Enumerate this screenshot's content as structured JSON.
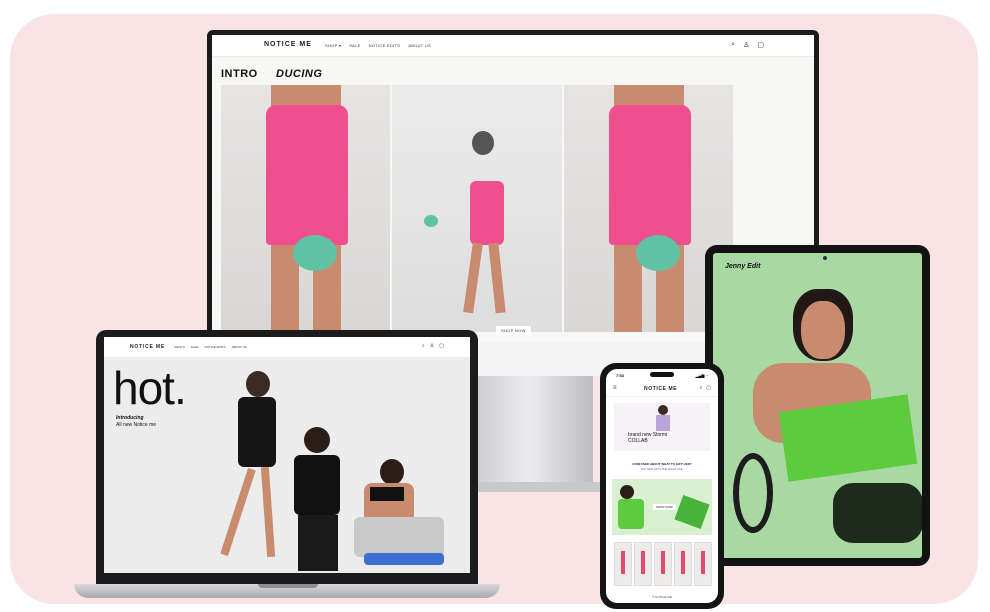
{
  "monitor": {
    "logo": "NOTICE ME",
    "nav_links": [
      "SHOP ▾",
      "SALE",
      "NOTICE EDITS",
      "ABOUT US"
    ],
    "icons": [
      "search-icon",
      "user-icon",
      "cart-icon"
    ],
    "heading_left": "INTRO",
    "heading_right": "DUCING",
    "shop_button": "SHOP NOW"
  },
  "laptop": {
    "logo": "NOTICE ME",
    "nav_links": [
      "SHOP ▾",
      "SALE",
      "NOTICE EDITS",
      "ABOUT US"
    ],
    "hero_word": "hot.",
    "intro_line1": "Introducing",
    "intro_line2": "All new Notice me"
  },
  "tablet": {
    "label": "Jenny Edit"
  },
  "phone": {
    "time": "7:53",
    "status_right": "▂▄▆ ◔",
    "logo": "NOTICE ME",
    "brand_line1": "brand new Stormi",
    "brand_line2": "COLLAB",
    "confused": "CONFUSED ABOUT WHAT TO GIFT HER?",
    "subtext": "BUY HER GIFTS SHE MIGHT LIKE",
    "shop_button": "SHOP NOW",
    "footer": "© NOTICE ME"
  },
  "colors": {
    "backdrop": "#f9e4e5",
    "dress_pink": "#ef4f8e",
    "tablet_green": "#a8d9a3",
    "accent_green": "#5fc2a3"
  }
}
